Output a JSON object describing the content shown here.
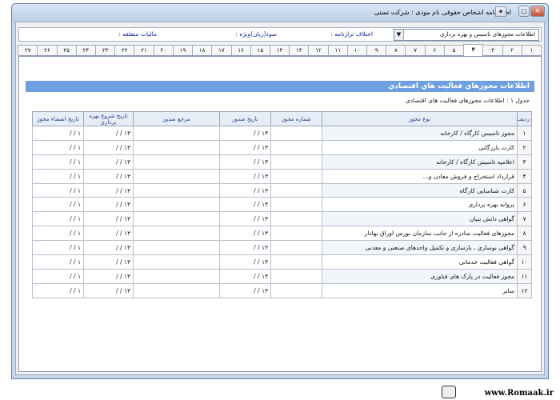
{
  "window": {
    "title": "اظهارنامه اشخاص حقوقی    نام مودی :  شرکت تستی",
    "controls": {
      "max": "□",
      "close": "✕",
      "extra": "◈"
    }
  },
  "infobar": {
    "combo_value": "اطلاعات مجوزهای تاسیس و بهره برداری",
    "combo_arrow": "▼",
    "field1": "اختلاف ترازنامه :",
    "field2": "سود(زیان)ویژه :",
    "field3": "مالیات متعلقه :"
  },
  "tabs": [
    "۱",
    "۲",
    "۳",
    "۴",
    "۵",
    "۶",
    "۷",
    "۸",
    "۹",
    "۱۰",
    "۱۱",
    "۱۲",
    "۱۳",
    "۱۴",
    "۱۵",
    "۱۶",
    "۱۷",
    "۱۸",
    "۱۹",
    "۲۰",
    "۲۱",
    "۲۲",
    "۲۳",
    "۲۴",
    "۲۵",
    "۲۶",
    "۲۷"
  ],
  "active_tab": "۴",
  "section": {
    "title": "اطلاعات مجوزهاي فعاليت هاي اقتصادي",
    "caption": "جدول ۱ : اطلاعات مجوزهای فعالیت های اقتصادی"
  },
  "table": {
    "headers": [
      "ردیف",
      "نوع مجوز",
      "شماره مجوز",
      "تاریخ صدور",
      "مرجع صدور",
      "تاریخ شروع بهره برداری",
      "تاریخ انقضاء مجوز"
    ],
    "date_placeholder": "۱۳ /  /",
    "date_placeholder_short": "/  /",
    "rows": [
      {
        "n": "۱",
        "type": "مجوز تاسیس کارگاه / کارخانه",
        "d1": "۱۳ /  /",
        "d2": "۱۳ /  /",
        "d3": "۱  /  /"
      },
      {
        "n": "۲",
        "type": "کارت بازرگانی",
        "d1": "۱۳ /  /",
        "d2": "۱۳ /  /",
        "d3": "۱  /  /"
      },
      {
        "n": "۳",
        "type": "اعلامیه تاسیس کارگاه / کارخانه",
        "d1": "۱۳ /  /",
        "d2": "۱۳ /  /",
        "d3": "۱  /  /"
      },
      {
        "n": "۴",
        "type": "قرارداد استخراج و فروش معادن و...",
        "d1": "۱۳ /  /",
        "d2": "۱۳ /  /",
        "d3": "۱  /  /"
      },
      {
        "n": "۵",
        "type": "کارت شناسایی کارگاه",
        "d1": "۱۳ /  /",
        "d2": "۱۳ /  /",
        "d3": "۱  /  /"
      },
      {
        "n": "۶",
        "type": "پروانه بهره برداری",
        "d1": "۱۳ /  /",
        "d2": "۱۳ /  /",
        "d3": "۱  /  /"
      },
      {
        "n": "۷",
        "type": "گواهی دانش بنیان",
        "d1": "۱۳ /  /",
        "d2": "۱۳ /  /",
        "d3": "۱  /  /"
      },
      {
        "n": "۸",
        "type": "مجوزهای فعالیت صادره از جانب سازمان بورس اوراق بهادار",
        "d1": "۱۳ /  /",
        "d2": "۱۳ /  /",
        "d3": "۱  /  /"
      },
      {
        "n": "۹",
        "type": "گواهی نوسازی ، بازسازی و تکمیل واحدهای صنعتی و معدنی",
        "d1": "۱۳ /  /",
        "d2": "۱۳ /  /",
        "d3": "۱  /  /"
      },
      {
        "n": "۱۰",
        "type": "گواهی فعالیت خدماتی",
        "d1": "۱۳ /  /",
        "d2": "۱۳ /  /",
        "d3": "۱  /  /"
      },
      {
        "n": "۱۱",
        "type": "مجوز فعالیت در پارک های فناوری",
        "d1": "۱۳ /  /",
        "d2": "۱۳ /  /",
        "d3": "۱  /  /"
      },
      {
        "n": "۱۲",
        "type": "سایر",
        "d1": "۱۳ /  /",
        "d2": "۱۳ /  /",
        "d3": "۱  /  /"
      }
    ]
  },
  "watermark": "www.Romaak.ir"
}
